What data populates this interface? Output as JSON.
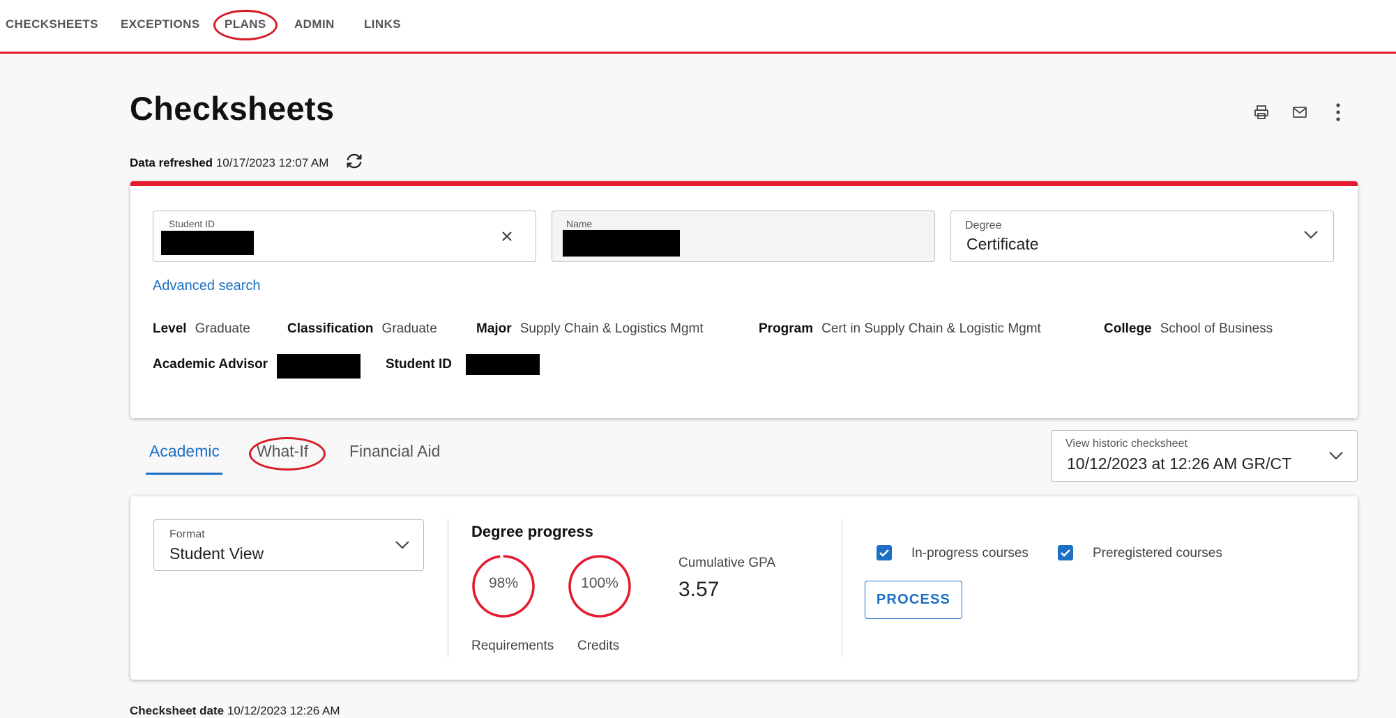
{
  "nav": {
    "items": [
      {
        "label": "CHECKSHEETS"
      },
      {
        "label": "EXCEPTIONS"
      },
      {
        "label": "PLANS"
      },
      {
        "label": "ADMIN"
      },
      {
        "label": "LINKS"
      }
    ]
  },
  "page": {
    "title": "Checksheets",
    "refreshed_label": "Data refreshed",
    "refreshed_value": "10/17/2023 12:07 AM",
    "icons": [
      "print-icon",
      "mail-icon",
      "more-vertical-icon",
      "refresh-icon"
    ]
  },
  "student": {
    "student_id_label": "Student ID",
    "name_label": "Name",
    "degree_label": "Degree",
    "degree_value": "Certificate",
    "advanced_search": "Advanced search",
    "meta": [
      {
        "label": "Level",
        "value": "Graduate"
      },
      {
        "label": "Classification",
        "value": "Graduate"
      },
      {
        "label": "Major",
        "value": "Supply Chain & Logistics Mgmt"
      },
      {
        "label": "Program",
        "value": "Cert in Supply Chain & Logistic Mgmt"
      },
      {
        "label": "College",
        "value": "School of Business"
      }
    ],
    "advisor_label": "Academic Advisor",
    "student_id_label2": "Student ID"
  },
  "tabs": [
    {
      "label": "Academic",
      "active": true
    },
    {
      "label": "What-If",
      "active": false
    },
    {
      "label": "Financial Aid",
      "active": false
    }
  ],
  "historic": {
    "label": "View historic checksheet",
    "value": "10/12/2023 at 12:26 AM GR/CT"
  },
  "format": {
    "label": "Format",
    "value": "Student View"
  },
  "progress": {
    "title": "Degree progress",
    "requirements_pct": 98,
    "requirements_text": "98%",
    "requirements_label": "Requirements",
    "credits_pct": 100,
    "credits_text": "100%",
    "credits_label": "Credits",
    "gpa_label": "Cumulative GPA",
    "gpa_value": "3.57"
  },
  "options": {
    "inprogress_label": "In-progress courses",
    "inprogress_checked": true,
    "prereg_label": "Preregistered courses",
    "prereg_checked": true,
    "process_label": "PROCESS"
  },
  "footer": {
    "date_label": "Checksheet date",
    "date_value": "10/12/2023 12:26 AM"
  },
  "colors": {
    "accent": "#e31b2f",
    "link": "#1c6fc4"
  }
}
